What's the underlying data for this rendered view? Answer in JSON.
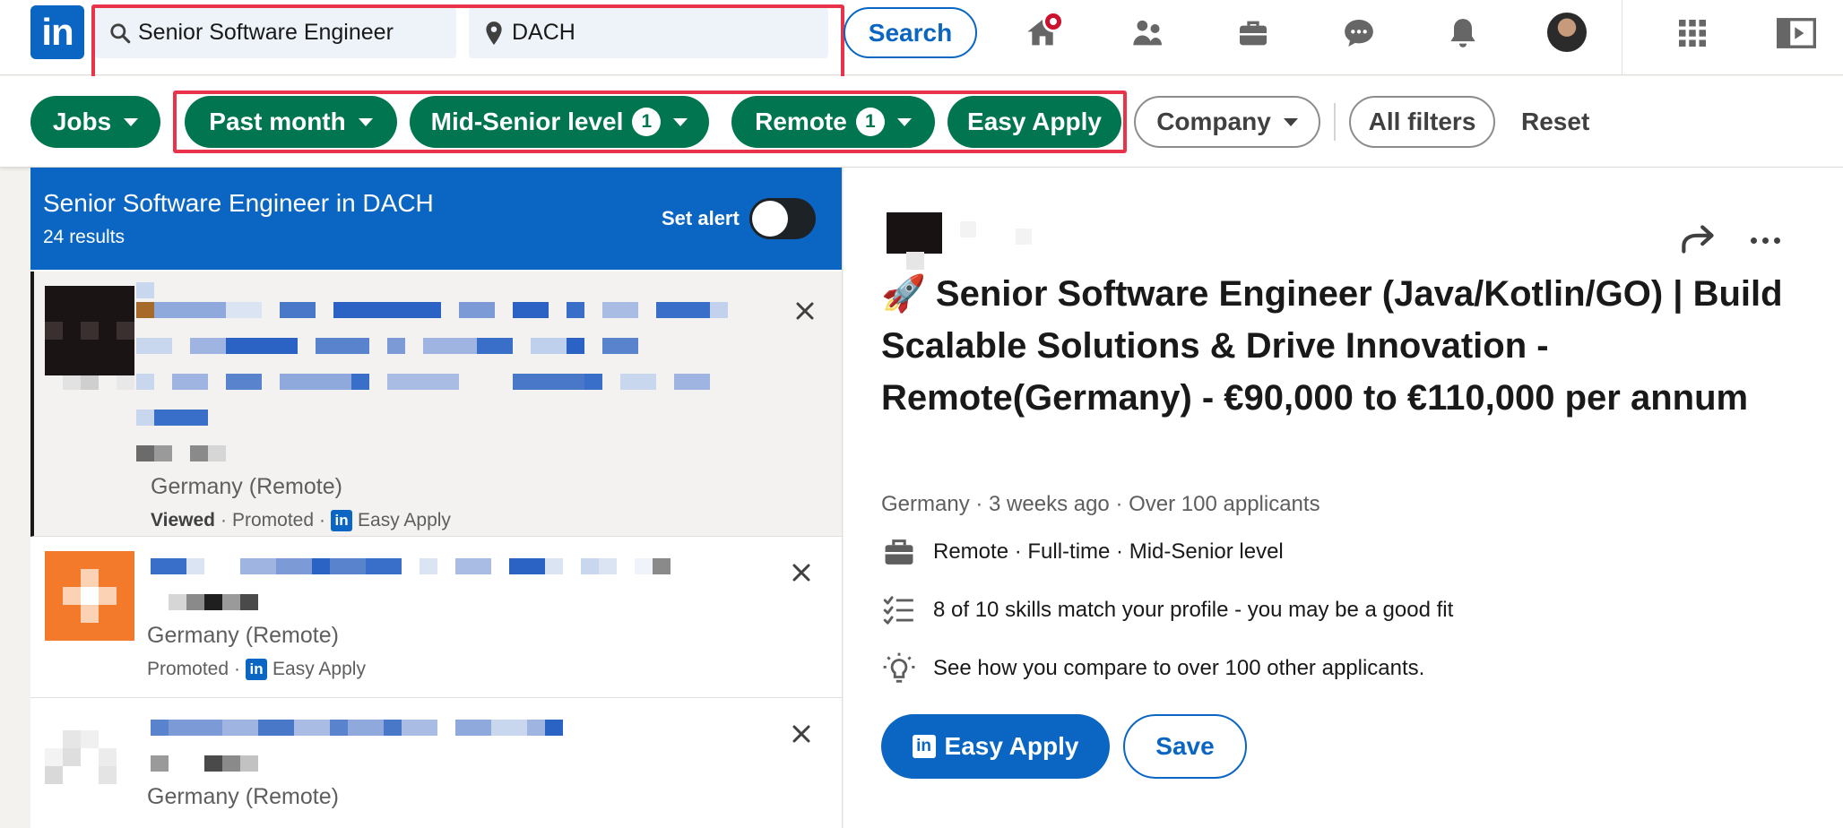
{
  "brand": {
    "logo_text": "in",
    "accent": "#0a66c2",
    "filter_green": "#01754f",
    "highlight_red": "#e8334a"
  },
  "search": {
    "keywords_value": "Senior Software Engineer",
    "location_value": "DACH",
    "button_label": "Search"
  },
  "nav": {
    "icons": [
      "home-icon",
      "my-network-icon",
      "jobs-icon",
      "messaging-icon",
      "notifications-icon",
      "avatar",
      "grid-apps-icon",
      "learning-icon"
    ]
  },
  "filters": {
    "jobs": "Jobs",
    "date_posted": "Past month",
    "experience": "Mid-Senior level",
    "experience_count": "1",
    "remote": "Remote",
    "remote_count": "1",
    "easy_apply": "Easy Apply",
    "company": "Company",
    "all_filters": "All filters",
    "reset": "Reset"
  },
  "results": {
    "title": "Senior Software Engineer in DACH",
    "count": "24 results",
    "set_alert": "Set alert",
    "cards": [
      {
        "location": "Germany (Remote)",
        "viewed": "Viewed",
        "promoted": "Promoted",
        "easy_apply": "Easy Apply",
        "sep": "·"
      },
      {
        "location": "Germany (Remote)",
        "promoted": "Promoted",
        "easy_apply": "Easy Apply",
        "sep": "·"
      },
      {
        "location": "Germany (Remote)"
      }
    ]
  },
  "job": {
    "title": "🚀 Senior Software Engineer (Java/Kotlin/GO) | Build Scalable Solutions & Drive Innovation - Remote(Germany) - €90,000 to €110,000 per annum",
    "subtitle": "Germany · 3 weeks ago · Over 100 applicants",
    "insight_workplace": "Remote · Full-time · Mid-Senior level",
    "insight_skills": "8 of 10 skills match your profile - you may be a good fit",
    "insight_compare": "See how you compare to over 100 other applicants.",
    "apply_label": "Easy Apply",
    "save_label": "Save"
  }
}
